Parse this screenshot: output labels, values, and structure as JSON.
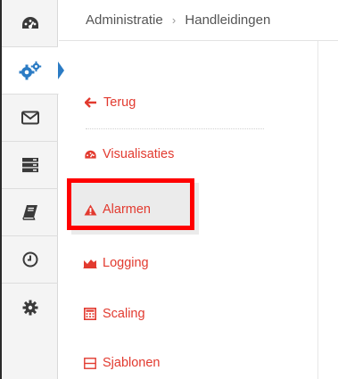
{
  "breadcrumb": {
    "parent": "Administratie",
    "separator": "›",
    "current": "Handleidingen"
  },
  "rail": {
    "items": [
      {
        "icon": "dashboard-gauge-icon",
        "active": false
      },
      {
        "icon": "gears-icon",
        "active": true
      },
      {
        "icon": "envelope-icon",
        "active": false
      },
      {
        "icon": "server-icon",
        "active": false
      },
      {
        "icon": "book-icon",
        "active": false
      },
      {
        "icon": "clock-icon",
        "active": false
      },
      {
        "icon": "gear-icon",
        "active": false
      }
    ]
  },
  "submenu": {
    "back_label": "Terug",
    "items": [
      {
        "label": "Visualisaties",
        "icon": "dashboard-gauge-icon"
      },
      {
        "label": "Alarmen",
        "icon": "warning-icon",
        "highlighted": true
      },
      {
        "label": "Logging",
        "icon": "area-chart-icon"
      },
      {
        "label": "Scaling",
        "icon": "calculator-icon"
      },
      {
        "label": "Sjablonen",
        "icon": "template-icon"
      }
    ]
  },
  "colors": {
    "accent": "#e23a2f",
    "highlight_box": "#ff0000",
    "active_marker": "#2b7bc4",
    "rail_bg": "#f4f4f4"
  }
}
